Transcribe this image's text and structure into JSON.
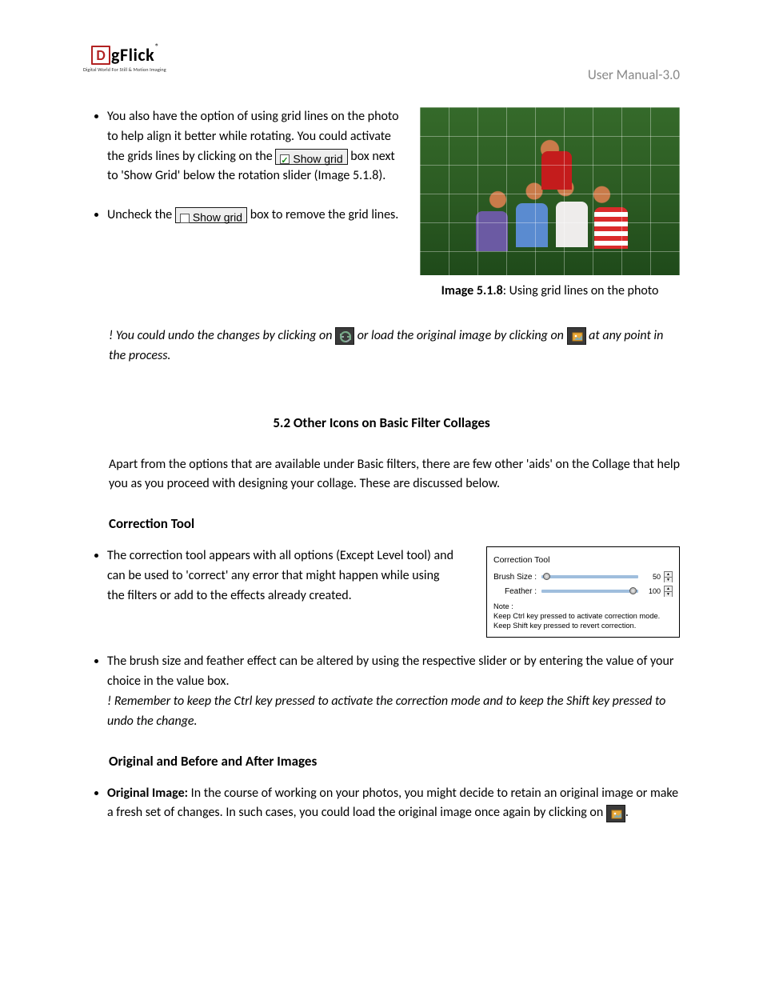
{
  "header": {
    "logo_d": "D",
    "logo_g": "g",
    "logo_flick": "Flick",
    "logo_reg": "®",
    "tagline": "Digital World For Still & Motion Imaging",
    "manual": "User Manual-3.0"
  },
  "bullets_top": {
    "b1a": "You also have the option of using grid lines on the photo to help align it better while rotating. You could activate the grids lines by clicking on the ",
    "show_grid_on": "Show grid",
    "b1b": " box next to 'Show Grid' below the rotation slider (Image 5.1.8).",
    "b2a": "Uncheck the ",
    "show_grid_off": "Show grid",
    "b2b": " box to remove the grid lines."
  },
  "image518": {
    "label_bold": "Image 5.1.8",
    "label_rest": ": Using grid lines on the photo"
  },
  "note": {
    "a": "! You could undo the changes by clicking on ",
    "b": " or load the original image by clicking on ",
    "c": " at any point in the process."
  },
  "sec52": {
    "heading": "5.2 Other Icons on Basic Filter Collages",
    "intro": "Apart from the options that are available under Basic filters, there are few other 'aids' on the Collage that help you as you proceed with designing your collage. These are discussed below.",
    "correction_head": "Correction Tool",
    "corr_bullet1": "The correction tool appears with all options (Except Level tool) and can be used to 'correct' any error that might happen while using the filters or add to the effects already created.",
    "corr_bullet2": "The brush size and feather effect can be altered by using the respective slider or by entering the value of your choice in the value box.",
    "corr_bullet2_note": "! Remember to keep the Ctrl key pressed to activate the correction mode and to keep the Shift key pressed to undo the change.",
    "orig_head": "Original and Before and After Images",
    "orig_bullet_bold": "Original Image:",
    "orig_bullet_a": " In the course of working on your photos, you might decide to retain an original image or make a fresh set of changes. In such cases, you could load the original image once again by clicking on ",
    "orig_bullet_b": "."
  },
  "correction_panel": {
    "title": "Correction Tool",
    "brush_label": "Brush Size :",
    "brush_value": "50",
    "feather_label": "Feather :",
    "feather_value": "100",
    "note_label": "Note :",
    "note1": "Keep Ctrl key pressed to activate correction mode.",
    "note2": "Keep Shift key pressed to revert correction."
  }
}
